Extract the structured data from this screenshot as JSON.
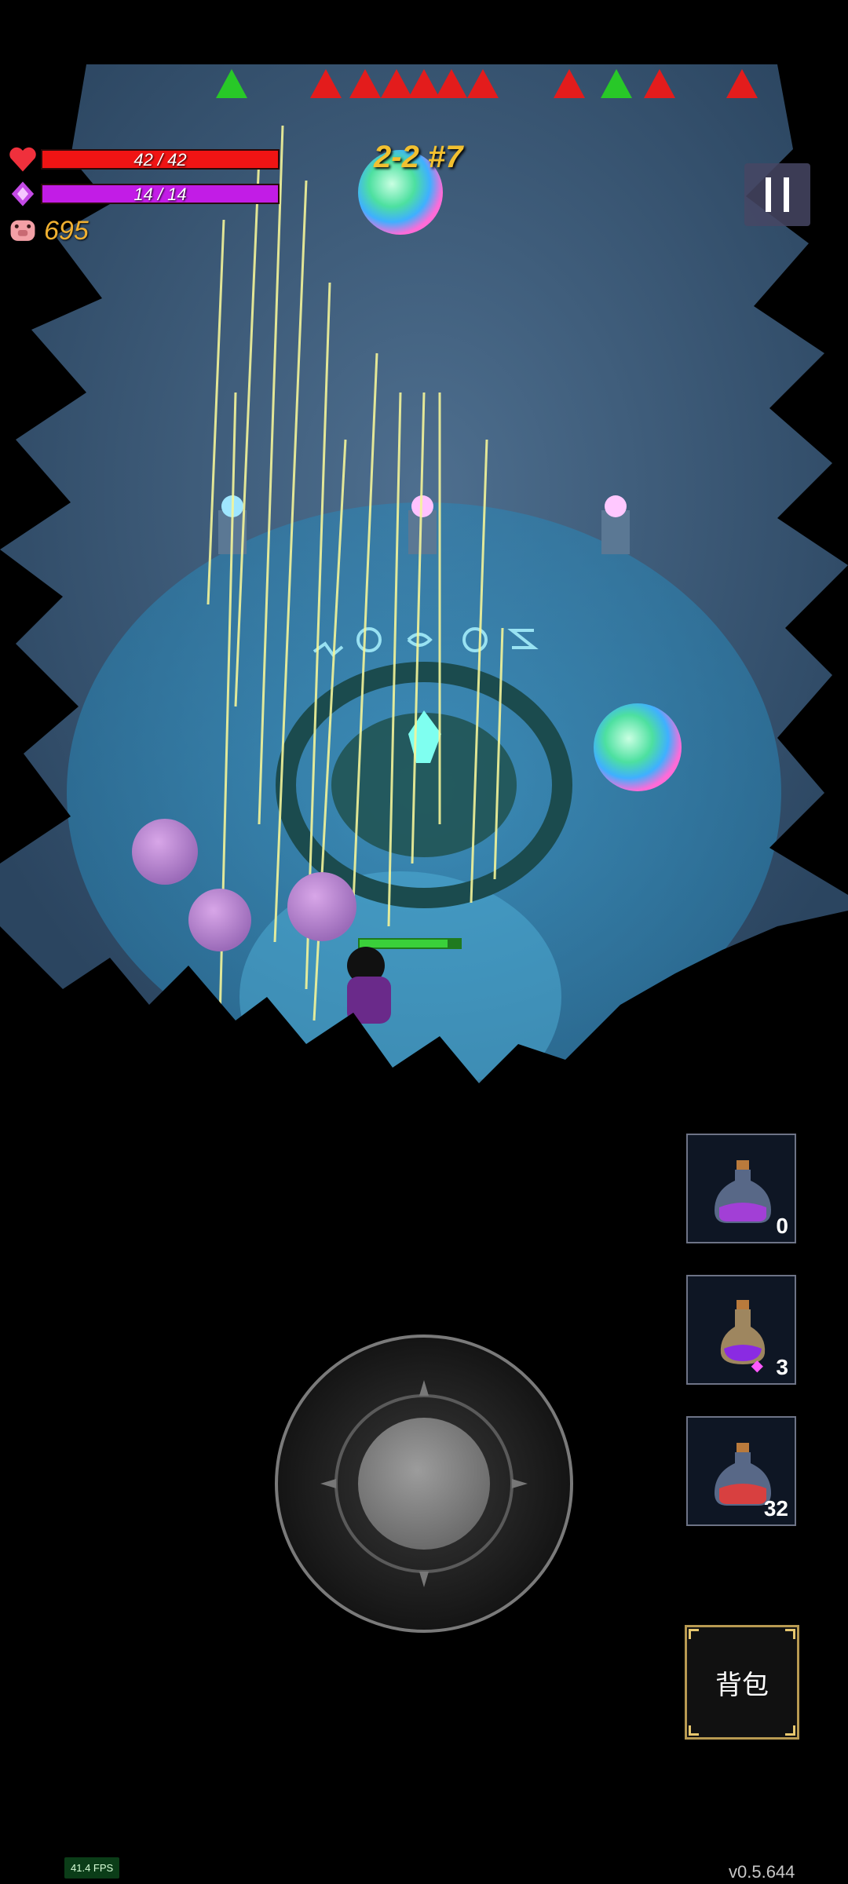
{
  "hud": {
    "hp_text": "42 / 42",
    "hp_fill": 1.0,
    "mp_text": "14 / 14",
    "mp_fill": 1.0,
    "coins": "695",
    "stage": "2-2 #7"
  },
  "quick_slots": [
    {
      "icon": "purple-potion-icon",
      "count": "0"
    },
    {
      "icon": "gem-potion-icon",
      "count": "3",
      "currency": "◆"
    },
    {
      "icon": "red-potion-icon",
      "count": "32"
    }
  ],
  "bag_label": "背包",
  "fps_label": "41.4 FPS",
  "version_label": "v0.5.644",
  "colors": {
    "hp": "#f01414",
    "mp": "#c21ce6",
    "coins": "#f0b030",
    "stage": "#f2c030",
    "bag_border": "#b89a52"
  }
}
